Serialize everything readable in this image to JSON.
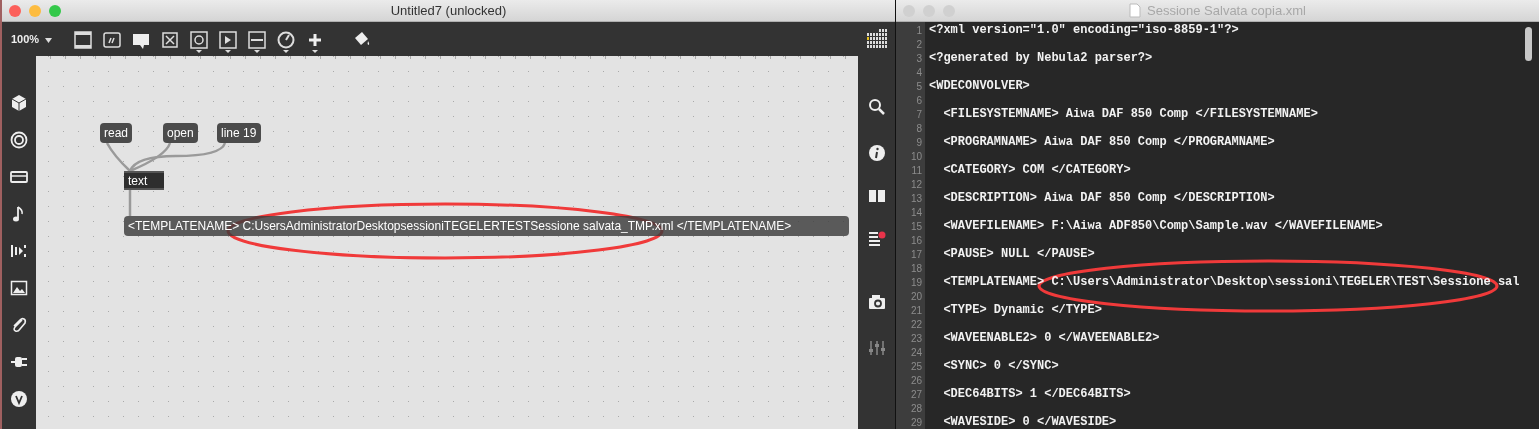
{
  "patcher_window": {
    "title": "Untitled7 (unlocked)",
    "active": true,
    "zoom": "100%",
    "objects": [
      {
        "kind": "message",
        "text": "read"
      },
      {
        "kind": "message",
        "text": "open"
      },
      {
        "kind": "message",
        "text": "line 19"
      },
      {
        "kind": "object",
        "text": "text"
      },
      {
        "kind": "message",
        "text": "<TEMPLATENAME> C:UsersAdministratorDesktopsessioniTEGELERTESTSessione salvata_TMP.xml </TEMPLATENAME>"
      }
    ]
  },
  "editor_window": {
    "title": "Sessione Salvata copia.xml",
    "active": false,
    "lines": [
      {
        "number": "1",
        "text": "<?xml version=\"1.0\" encoding=\"iso-8859-1\"?>"
      },
      {
        "number": "2"
      },
      {
        "number": "3",
        "text": "<?generated by Nebula2 parser?>"
      },
      {
        "number": "4"
      },
      {
        "number": "5",
        "text": "<WDECONVOLVER>"
      },
      {
        "number": "6"
      },
      {
        "number": "7",
        "text": "  <FILESYSTEMNAME> Aiwa DAF 850 Comp </FILESYSTEMNAME>"
      },
      {
        "number": "8"
      },
      {
        "number": "9",
        "text": "  <PROGRAMNAME> Aiwa DAF 850 Comp </PROGRAMNAME>"
      },
      {
        "number": "10"
      },
      {
        "number": "11",
        "text": "  <CATEGORY> COM </CATEGORY>"
      },
      {
        "number": "12"
      },
      {
        "number": "13",
        "text": "  <DESCRIPTION> Aiwa DAF 850 Comp </DESCRIPTION>"
      },
      {
        "number": "14"
      },
      {
        "number": "15",
        "text": "  <WAVEFILENAME> F:\\Aiwa ADF850\\Comp\\Sample.wav </WAVEFILENAME>"
      },
      {
        "number": "16"
      },
      {
        "number": "17",
        "text": "  <PAUSE> NULL </PAUSE>"
      },
      {
        "number": "18"
      },
      {
        "number": "19",
        "text": "  <TEMPLATENAME> C:\\Users\\Administrator\\Desktop\\sessioni\\TEGELER\\TEST\\Sessione sal"
      },
      {
        "number": "20"
      },
      {
        "number": "21",
        "text": "  <TYPE> Dynamic </TYPE>"
      },
      {
        "number": "22"
      },
      {
        "number": "23",
        "text": "  <WAVEENABLE2> 0 </WAVEENABLE2>"
      },
      {
        "number": "24"
      },
      {
        "number": "25",
        "text": "  <SYNC> 0 </SYNC>"
      },
      {
        "number": "26"
      },
      {
        "number": "27",
        "text": "  <DEC64BITS> 1 </DEC64BITS>"
      },
      {
        "number": "28"
      },
      {
        "number": "29",
        "text": "  <WAVESIDE> 0 </WAVESIDE>"
      }
    ]
  }
}
